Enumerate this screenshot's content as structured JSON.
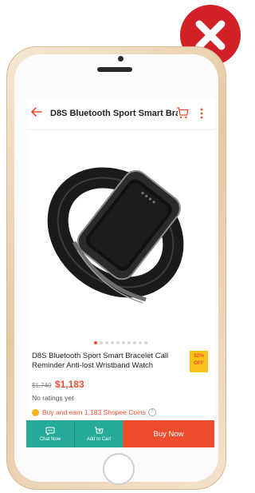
{
  "header": {
    "title": "D8S Bluetooth Sport Smart Bra...",
    "back_icon": "arrow-left-icon",
    "cart_icon": "cart-icon",
    "more_icon": "more-vertical-icon"
  },
  "product": {
    "name": "D8S Bluetooth Sport Smart Bracelet Call Reminder Anti-lost Wristband Watch",
    "discount_percent": "32%",
    "discount_label": "OFF",
    "old_price": "$1,740",
    "new_price": "$1,183",
    "ratings": "No ratings yet",
    "coins_text": "Buy and earn 1,183 Shopee Coins",
    "carousel_total": 10,
    "carousel_active": 1
  },
  "bottom_bar": {
    "chat_label": "Chat Now",
    "add_cart_label": "Add to Cart",
    "buy_label": "Buy Now"
  },
  "colors": {
    "accent": "#ee4d2d",
    "teal": "#26aa99",
    "badge_yellow": "#f7c21a",
    "reject_red": "#d12026"
  }
}
